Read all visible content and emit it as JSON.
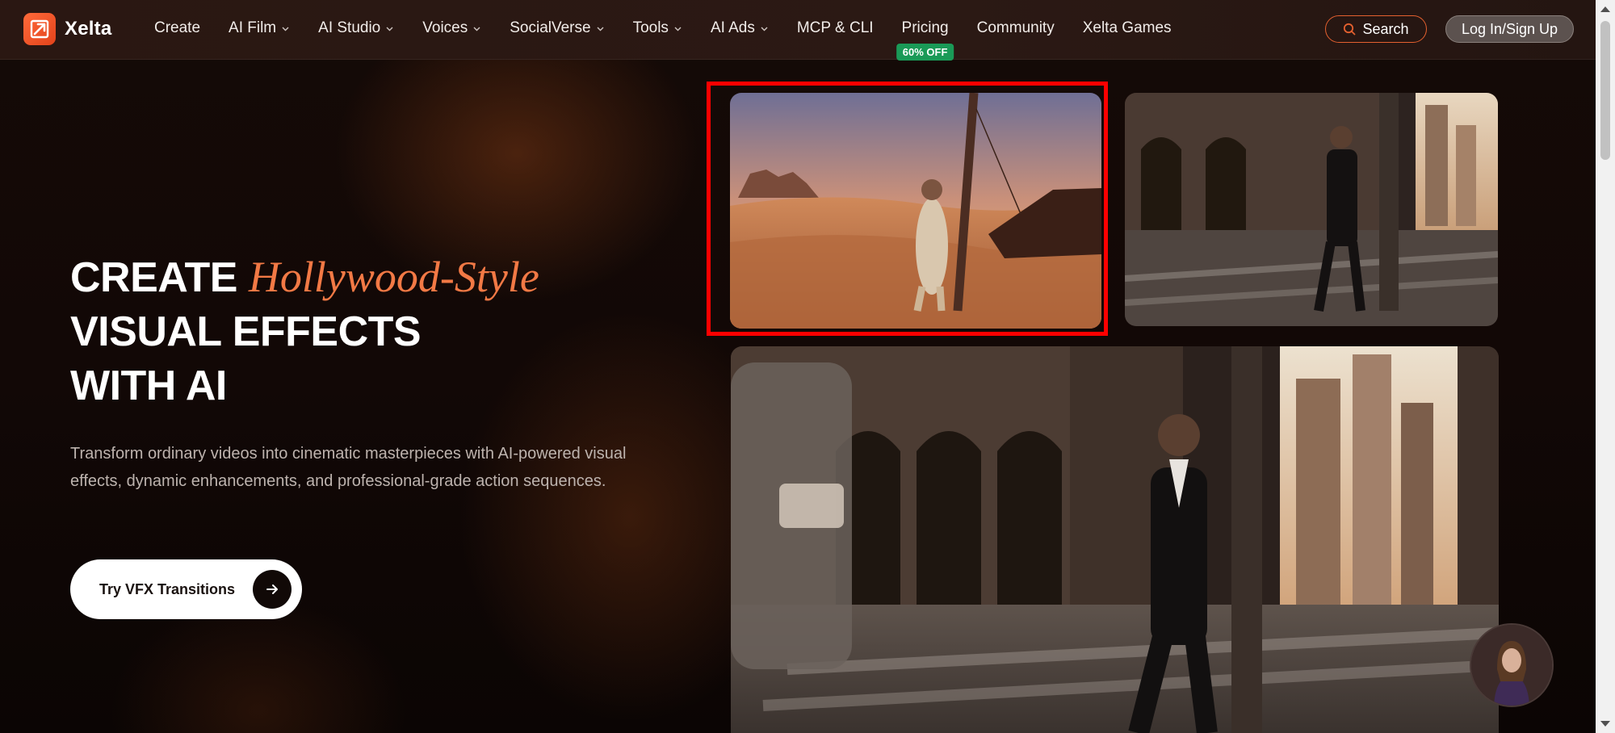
{
  "brand": {
    "name": "Xelta",
    "accent_color": "#e8532a"
  },
  "nav": {
    "items": [
      {
        "label": "Create",
        "dropdown": false
      },
      {
        "label": "AI Film",
        "dropdown": true
      },
      {
        "label": "AI Studio",
        "dropdown": true
      },
      {
        "label": "Voices",
        "dropdown": true
      },
      {
        "label": "SocialVerse",
        "dropdown": true
      },
      {
        "label": "Tools",
        "dropdown": true
      },
      {
        "label": "AI Ads",
        "dropdown": true
      },
      {
        "label": "MCP & CLI",
        "dropdown": false
      },
      {
        "label": "Pricing",
        "dropdown": false,
        "badge": "60% OFF"
      },
      {
        "label": "Community",
        "dropdown": false
      },
      {
        "label": "Xelta Games",
        "dropdown": false
      }
    ],
    "search_label": "Search",
    "login_label": "Log In/Sign Up",
    "badge_color": "#1a9a57"
  },
  "hero": {
    "title_prefix": "CREATE",
    "title_accent": "Hollywood-Style",
    "title_line2": "VISUAL EFFECTS",
    "title_line3": "WITH AI",
    "accent_color": "#f27945",
    "description": "Transform ordinary videos into cinematic masterpieces with AI-powered visual effects, dynamic enhancements, and professional-grade action sequences.",
    "cta_label": "Try VFX Transitions"
  },
  "media": {
    "cards": [
      {
        "scene": "desert-man-leaning-on-pole",
        "selected": true
      },
      {
        "scene": "city-street-man-in-suit-small",
        "selected": false
      },
      {
        "scene": "city-street-man-in-suit-large",
        "selected": false
      }
    ],
    "highlight_color": "#ff0000"
  },
  "icons": {
    "logo": "xelta-logo-icon",
    "chevron": "chevron-down-icon",
    "search": "search-icon",
    "arrow": "arrow-right-icon",
    "assistant": "assistant-avatar-icon"
  }
}
